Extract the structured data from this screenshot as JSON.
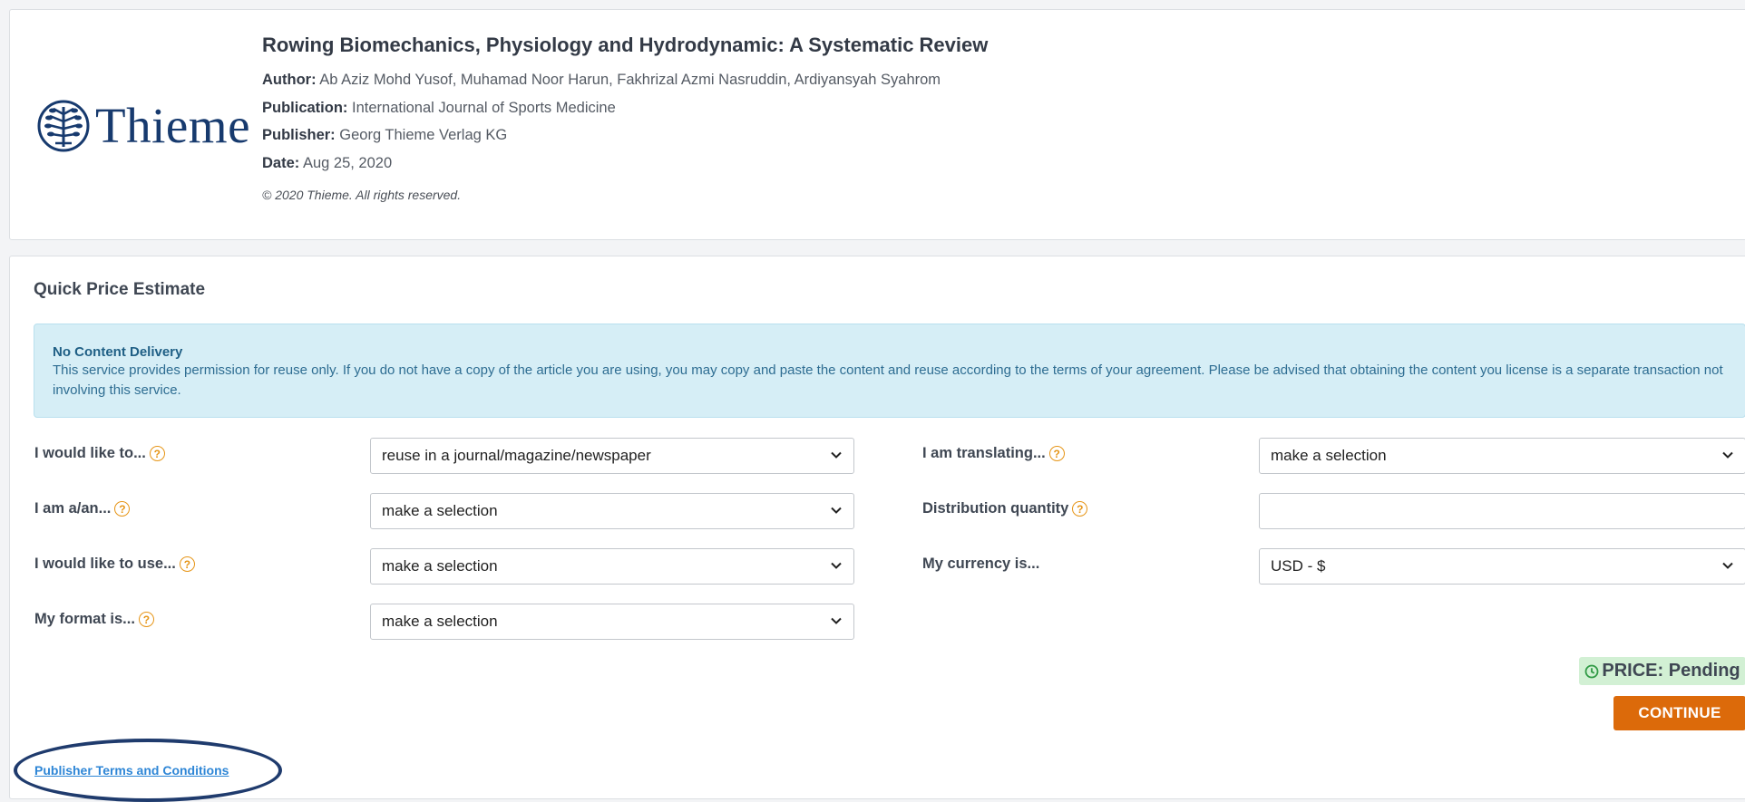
{
  "article": {
    "logo_text": "Thieme",
    "title": "Rowing Biomechanics, Physiology and Hydrodynamic: A Systematic Review",
    "author_label": "Author:",
    "author_value": "Ab Aziz Mohd Yusof, Muhamad Noor Harun, Fakhrizal Azmi Nasruddin, Ardiyansyah Syahrom",
    "publication_label": "Publication:",
    "publication_value": "International Journal of Sports Medicine",
    "publisher_label": "Publisher:",
    "publisher_value": "Georg Thieme Verlag KG",
    "date_label": "Date:",
    "date_value": "Aug 25, 2020",
    "copyright": "© 2020 Thieme. All rights reserved."
  },
  "estimate": {
    "title": "Quick Price Estimate",
    "notice_title": "No Content Delivery",
    "notice_body": "This service provides permission for reuse only. If you do not have a copy of the article you are using, you may copy and paste the content and reuse according to the terms of your agreement. Please be advised that obtaining the content you license is a separate transaction not involving this service.",
    "fields": {
      "would_like_to": {
        "label": "I would like to...",
        "value": "reuse in a journal/magazine/newspaper"
      },
      "i_am": {
        "label": "I am a/an...",
        "value": "make a selection"
      },
      "would_like_to_use": {
        "label": "I would like to use...",
        "value": "make a selection"
      },
      "format": {
        "label": "My format is...",
        "value": "make a selection"
      },
      "translating": {
        "label": "I am translating...",
        "value": "make a selection"
      },
      "distribution_quantity": {
        "label": "Distribution quantity",
        "value": ""
      },
      "currency": {
        "label": "My currency is...",
        "value": "USD - $"
      }
    },
    "price_label": "PRICE:",
    "price_value": "Pending",
    "continue_label": "CONTINUE",
    "terms_link": "Publisher Terms and Conditions"
  },
  "colors": {
    "accent": "#dc6a0a",
    "help_icon": "#e69517",
    "link": "#2e86d6",
    "notice_bg": "#d6eef6",
    "price_bg": "#d2f0d4",
    "logo": "#173a6e"
  },
  "icons": [
    "thieme-tree-logo-icon",
    "help-icon",
    "chevron-down-icon",
    "clock-icon"
  ]
}
